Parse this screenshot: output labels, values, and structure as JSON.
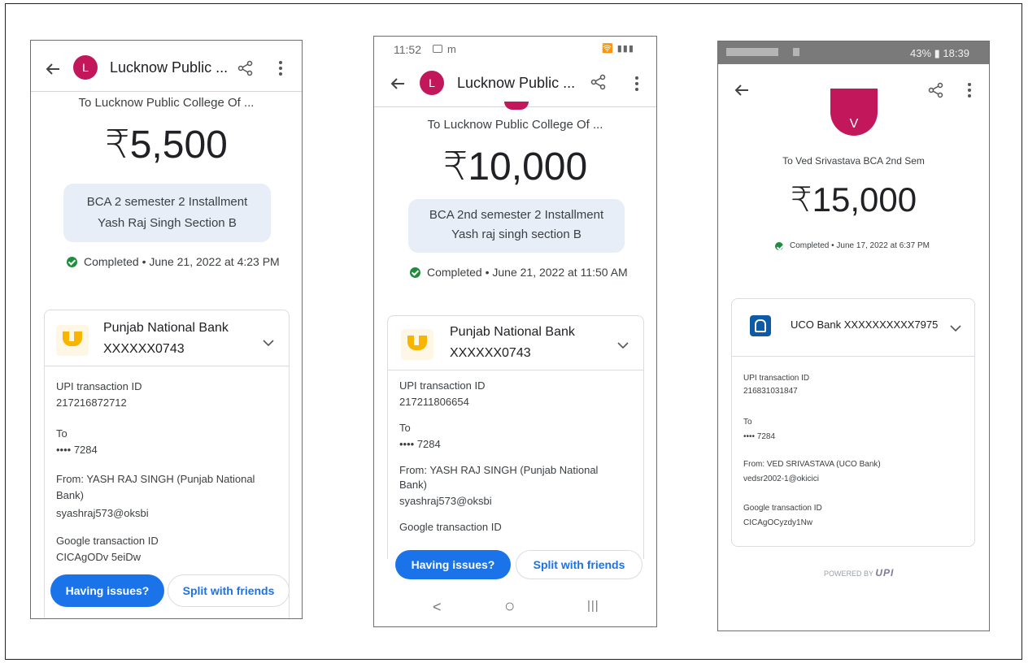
{
  "phones": [
    {
      "header": {
        "title": "Lucknow Public ...",
        "avatar_letter": "L"
      },
      "payee": "To Lucknow Public College Of ...",
      "amount": "₹5,500",
      "note": {
        "line1": "BCA 2 semester 2 Installment",
        "line2": "Yash Raj Singh Section B"
      },
      "status": "Completed • June 21, 2022 at 4:23 PM",
      "bank": {
        "name": "Punjab National Bank",
        "account": "XXXXXX0743"
      },
      "details": {
        "upi_label": "UPI transaction ID",
        "upi_value": "217216872712",
        "to_label": "To",
        "to_value": "•••• 7284",
        "from_line1": "From: YASH RAJ SINGH (Punjab National",
        "from_line2": "Bank)",
        "from_vpa": "syashraj573@oksbi",
        "google_label": "Google transaction ID",
        "google_value": "CICAgODv 5eiDw"
      },
      "buttons": {
        "issues": "Having issues?",
        "split": "Split with friends"
      }
    },
    {
      "statusbar": {
        "time": "11:52",
        "right": "🛜 ▮▮▮"
      },
      "header": {
        "title": "Lucknow Public ...",
        "avatar_letter": "L"
      },
      "payee": "To Lucknow Public College Of ...",
      "amount": "₹10,000",
      "note": {
        "line1": "BCA 2nd semester 2 Installment",
        "line2": "Yash raj singh section B"
      },
      "status": "Completed • June 21, 2022 at 11:50 AM",
      "bank": {
        "name": "Punjab National Bank",
        "account": "XXXXXX0743"
      },
      "details": {
        "upi_label": "UPI transaction ID",
        "upi_value": "217211806654",
        "to_label": "To",
        "to_value": "•••• 7284",
        "from_line1": "From: YASH RAJ SINGH (Punjab National",
        "from_line2": "Bank)",
        "from_vpa": "syashraj573@oksbi",
        "google_label": "Google transaction ID"
      },
      "buttons": {
        "issues": "Having issues?",
        "split": "Split with friends"
      },
      "navbar": {
        "back": "<",
        "home": "○",
        "recents": "|||"
      }
    },
    {
      "statusbar": {
        "right": "43% ▮ 18:39"
      },
      "header": {
        "avatar_letter": "V"
      },
      "payee": "To Ved Srivastava BCA 2nd Sem",
      "amount": "₹15,000",
      "status": "Completed • June 17, 2022 at 6:37 PM",
      "bank": {
        "name": "UCO Bank XXXXXXXXXX7975"
      },
      "details": {
        "upi_label": "UPI transaction ID",
        "upi_value": "216831031847",
        "to_label": "To",
        "to_value": "•••• 7284",
        "from_line1": "From: VED SRIVASTAVA (UCO Bank)",
        "from_vpa": "vedsr2002-1@okicici",
        "google_label": "Google transaction ID",
        "google_value": "CICAgOCyzdy1Nw"
      },
      "footer": {
        "powered_by": "POWERED BY",
        "upi": "UPI"
      }
    }
  ],
  "colors": {
    "primary": "#1a73e8",
    "avatar": "#c2185b",
    "success": "#1e8e3e",
    "note_bg": "#e7eef8",
    "pnb_yellow": "#f7b500",
    "uco_blue": "#0d5aa7"
  },
  "icons": [
    "back-arrow-icon",
    "share-icon",
    "more-vert-icon",
    "check-circle-icon",
    "chevron-down-icon",
    "pnb-logo-icon",
    "uco-logo-icon"
  ]
}
